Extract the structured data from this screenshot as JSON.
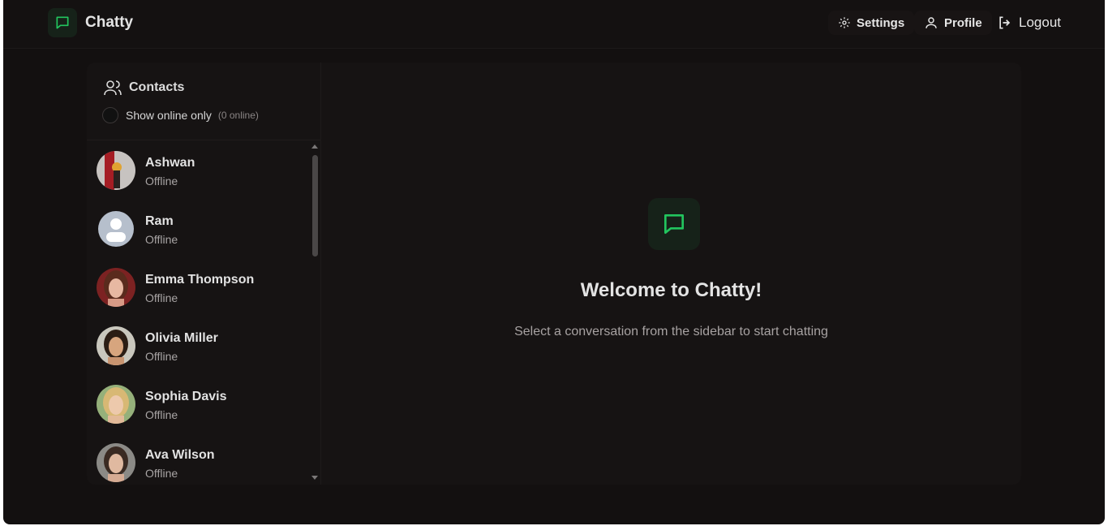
{
  "app": {
    "name": "Chatty",
    "accent": "#22c55e"
  },
  "nav": {
    "settings_label": "Settings",
    "profile_label": "Profile",
    "logout_label": "Logout"
  },
  "sidebar": {
    "title": "Contacts",
    "online_filter_label": "Show online only",
    "online_count": "(0 online)",
    "contacts": [
      {
        "name": "Ashwan",
        "status": "Offline",
        "avatar": "photo-avatar"
      },
      {
        "name": "Ram",
        "status": "Offline",
        "avatar": "default-user-avatar"
      },
      {
        "name": "Emma Thompson",
        "status": "Offline",
        "avatar": "photo-avatar"
      },
      {
        "name": "Olivia Miller",
        "status": "Offline",
        "avatar": "photo-avatar"
      },
      {
        "name": "Sophia Davis",
        "status": "Offline",
        "avatar": "photo-avatar"
      },
      {
        "name": "Ava Wilson",
        "status": "Offline",
        "avatar": "photo-avatar"
      }
    ]
  },
  "welcome": {
    "title": "Welcome to Chatty!",
    "subtitle": "Select a conversation from the sidebar to start chatting"
  }
}
